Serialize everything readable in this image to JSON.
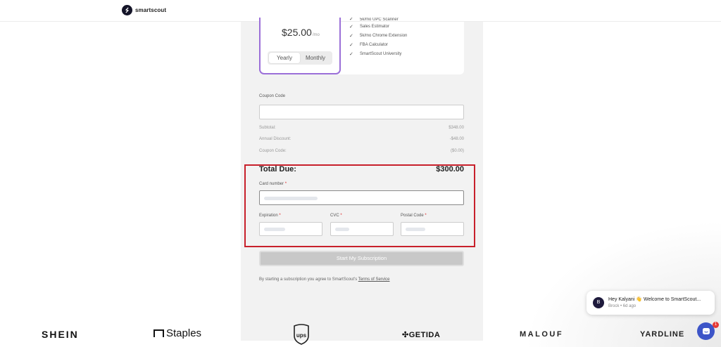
{
  "header": {
    "brand": "smartscout"
  },
  "plan": {
    "price": "$25.00",
    "price_unit": "/mo",
    "billing_options": [
      "Yearly",
      "Monthly"
    ],
    "features": [
      "5k/mo UPC Scanner",
      "Sales Estimator",
      "5k/mo Chrome Extension",
      "FBA Calculator",
      "SmartScout University"
    ]
  },
  "coupon": {
    "label": "Coupon Code",
    "value": "",
    "placeholder": ""
  },
  "summary": [
    {
      "label": "Subtotal:",
      "value": "$348.00"
    },
    {
      "label": "Annual Discount:",
      "value": "-$48.00"
    },
    {
      "label": "Coupon Code:",
      "value": "($0.00)"
    }
  ],
  "total": {
    "label": "Total Due:",
    "value": "$300.00"
  },
  "payment": {
    "card_label": "Card number",
    "expiration_label": "Expiration",
    "cvc_label": "CVC",
    "postal_label": "Postal Code",
    "required_mark": "*"
  },
  "submit_label": "Start My Subscription",
  "terms": {
    "prefix": "By starting a subscription you agree to SmartScout's",
    "link": "Terms of Service"
  },
  "brands": [
    "SHEIN",
    "Staples",
    "ups",
    "GETIDA",
    "MALOUF",
    "YARDLINE"
  ],
  "chat": {
    "avatar_initial": "B",
    "message": "Hey Kalyani 👋 Welcome to SmartScout...",
    "meta": "Brock • 6d ago",
    "badge": "1"
  },
  "colors": {
    "accent_purple": "#9b6fd8",
    "highlight_red": "#c8202b",
    "chat_blue": "#3d55c8"
  }
}
